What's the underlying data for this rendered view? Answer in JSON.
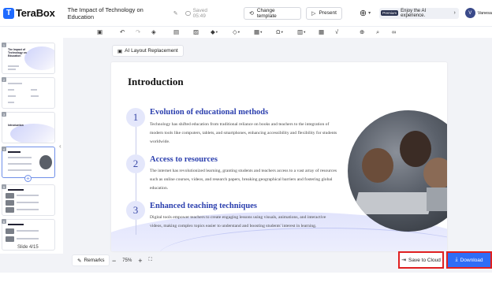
{
  "header": {
    "logo_text": "TeraBox",
    "logo_glyph": "T",
    "doc_title": "The Impact of Technology on Education",
    "saved_status": "Saved 05:49",
    "change_template_label": "Change template",
    "present_label": "Present",
    "promo_badge": "Premium",
    "promo_text": "Enjoy the AI experience.",
    "avatar_initial": "V",
    "user_name": "Vanesa"
  },
  "toolbar": {
    "icons": [
      "new-slide-icon",
      "undo-icon",
      "redo-icon",
      "format-painter-icon",
      "text-icon",
      "image-icon",
      "shape-icon",
      "chart-icon",
      "symbol-icon",
      "chart-bar-icon",
      "table-icon",
      "formula-icon",
      "add-icon",
      "search-icon",
      "link-icon"
    ]
  },
  "sidebar": {
    "slide_counter": "Slide 4/15",
    "thumbnails": [
      {
        "num": "1",
        "title": "The Impact of Technology on Education"
      },
      {
        "num": "2",
        "title": ""
      },
      {
        "num": "3",
        "title": "Introduction"
      },
      {
        "num": "4",
        "title": ""
      },
      {
        "num": "5",
        "title": ""
      },
      {
        "num": "6",
        "title": ""
      }
    ]
  },
  "canvas": {
    "ai_layout_label": "AI Layout Replacement",
    "slide": {
      "title": "Introduction",
      "points": [
        {
          "num": "1",
          "title": "Evolution of educational methods",
          "text": "Technology has shifted education from traditional reliance on books and teachers to the integration of modern tools like computers, tablets, and smartphones, enhancing accessibility and flexibility for students worldwide."
        },
        {
          "num": "2",
          "title": "Access to resources",
          "text": "The internet has revolutionized learning, granting students and teachers access to a vast array of resources such as online courses, videos, and research papers, breaking geographical barriers and fostering global education."
        },
        {
          "num": "3",
          "title": "Enhanced teaching techniques",
          "text": "Digital tools empower teachers to create engaging lessons using visuals, animations, and interactive videos, making complex topics easier to understand and boosting students' interest in learning."
        }
      ]
    }
  },
  "bottom": {
    "remarks_label": "Remarks",
    "zoom_minus": "−",
    "zoom_level": "75%",
    "zoom_plus": "+",
    "save_cloud_label": "Save to Cloud",
    "download_label": "Download"
  },
  "colors": {
    "brand": "#1f6bff",
    "download_bg": "#2f6df6",
    "highlight": "#e02020",
    "point_title": "#2b3fae"
  }
}
